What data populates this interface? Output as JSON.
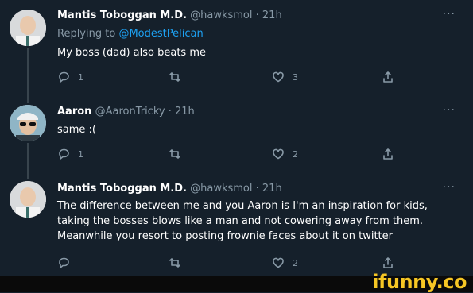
{
  "tweets": [
    {
      "name": "Mantis Toboggan M.D.",
      "handle": "@hawksmol",
      "time": "21h",
      "reply_prefix": "Replying to",
      "reply_mention": "@ModestPelican",
      "text": "My boss (dad) also beats me",
      "replies": "1",
      "retweets": "",
      "likes": "3"
    },
    {
      "name": "Aaron",
      "handle": "@AaronTricky",
      "time": "21h",
      "text": "same :(",
      "replies": "1",
      "retweets": "",
      "likes": "2"
    },
    {
      "name": "Mantis Toboggan M.D.",
      "handle": "@hawksmol",
      "time": "21h",
      "text_lines": [
        "The difference between me and you Aaron is I'm an inspiration for kids,",
        "taking the bosses blows like a man and not cowering away from them.",
        "Meanwhile you resort to posting frownie faces about it on twitter"
      ],
      "replies": "",
      "retweets": "",
      "likes": "2"
    }
  ],
  "more_glyph": "···",
  "separator": " · ",
  "watermark": "ifunny.co",
  "colors": {
    "background": "#15202b",
    "muted": "#8899a6",
    "mention": "#1da1f2",
    "watermark": "#f6c624"
  },
  "icons": [
    "reply-icon",
    "retweet-icon",
    "like-icon",
    "share-icon"
  ]
}
